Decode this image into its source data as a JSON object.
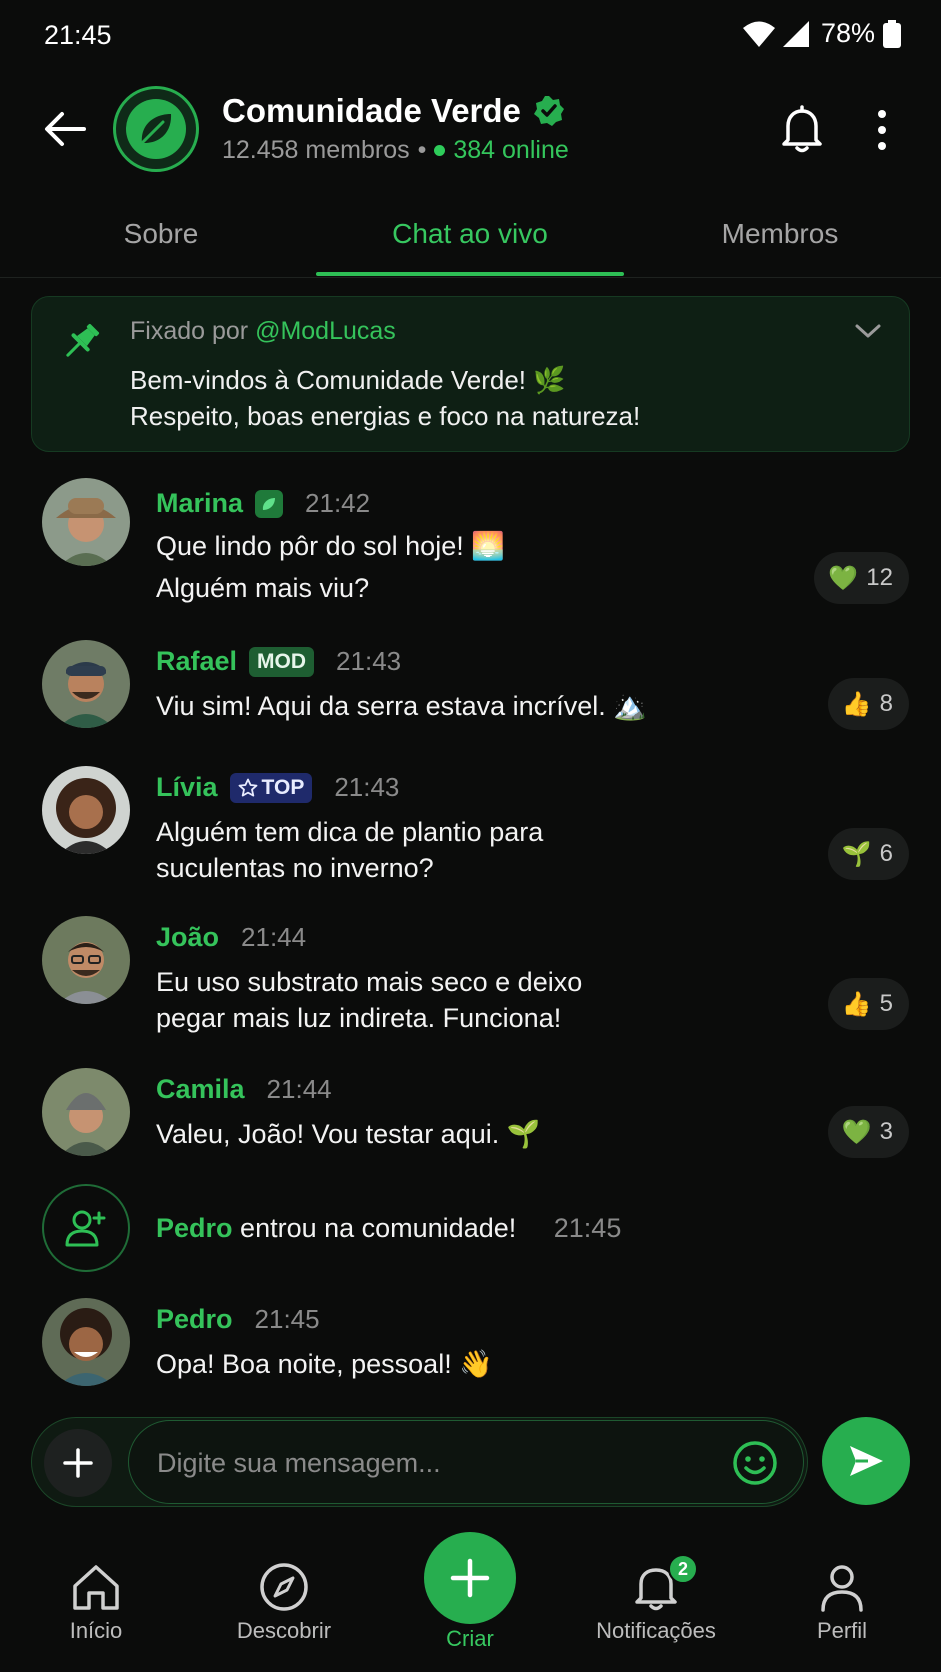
{
  "status_bar": {
    "time": "21:45",
    "battery": "78%"
  },
  "header": {
    "community_name": "Comunidade Verde",
    "members": "12.458 membros",
    "separator": "•",
    "online": "384 online"
  },
  "tabs": [
    {
      "label": "Sobre"
    },
    {
      "label": "Chat ao vivo"
    },
    {
      "label": "Membros"
    }
  ],
  "pinned": {
    "prefix": "Fixado por",
    "author": "@ModLucas",
    "line1": "Bem-vindos à Comunidade Verde! 🌿",
    "line2": "Respeito, boas energias e foco na natureza!"
  },
  "messages": [
    {
      "name": "Marina",
      "time": "21:42",
      "line1": "Que lindo pôr do sol hoje! 🌅",
      "line2": "Alguém mais viu?",
      "reaction_emoji": "💚",
      "reaction_count": "12"
    },
    {
      "name": "Rafael",
      "badge": "MOD",
      "time": "21:43",
      "line1": "Viu sim! Aqui da serra estava incrível. 🏔️",
      "reaction_emoji": "👍",
      "reaction_count": "8"
    },
    {
      "name": "Lívia",
      "badge": "TOP",
      "time": "21:43",
      "line1": "Alguém tem dica de plantio para",
      "line2": "suculentas no inverno?",
      "reaction_emoji": "🌱",
      "reaction_count": "6"
    },
    {
      "name": "João",
      "time": "21:44",
      "line1": "Eu uso substrato mais seco e deixo",
      "line2": "pegar mais luz indireta. Funciona!",
      "reaction_emoji": "👍",
      "reaction_count": "5"
    },
    {
      "name": "Camila",
      "time": "21:44",
      "line1": "Valeu, João! Vou testar aqui. 🌱",
      "reaction_emoji": "💚",
      "reaction_count": "3"
    },
    {
      "name": "Pedro",
      "time": "21:45",
      "line1": "Opa! Boa noite, pessoal! 👋"
    }
  ],
  "join_event": {
    "name": "Pedro",
    "text": "entrou na comunidade!",
    "time": "21:45"
  },
  "composer": {
    "placeholder": "Digite sua mensagem..."
  },
  "bottom_nav": [
    {
      "label": "Início",
      "icon": "home-icon"
    },
    {
      "label": "Descobrir",
      "icon": "compass-icon"
    },
    {
      "label": "Criar",
      "icon": "plus-icon"
    },
    {
      "label": "Notificações",
      "icon": "bell-icon",
      "badge": "2"
    },
    {
      "label": "Perfil",
      "icon": "person-icon"
    }
  ],
  "colors": {
    "accent": "#27ae4f",
    "background": "#0b0c0b"
  }
}
